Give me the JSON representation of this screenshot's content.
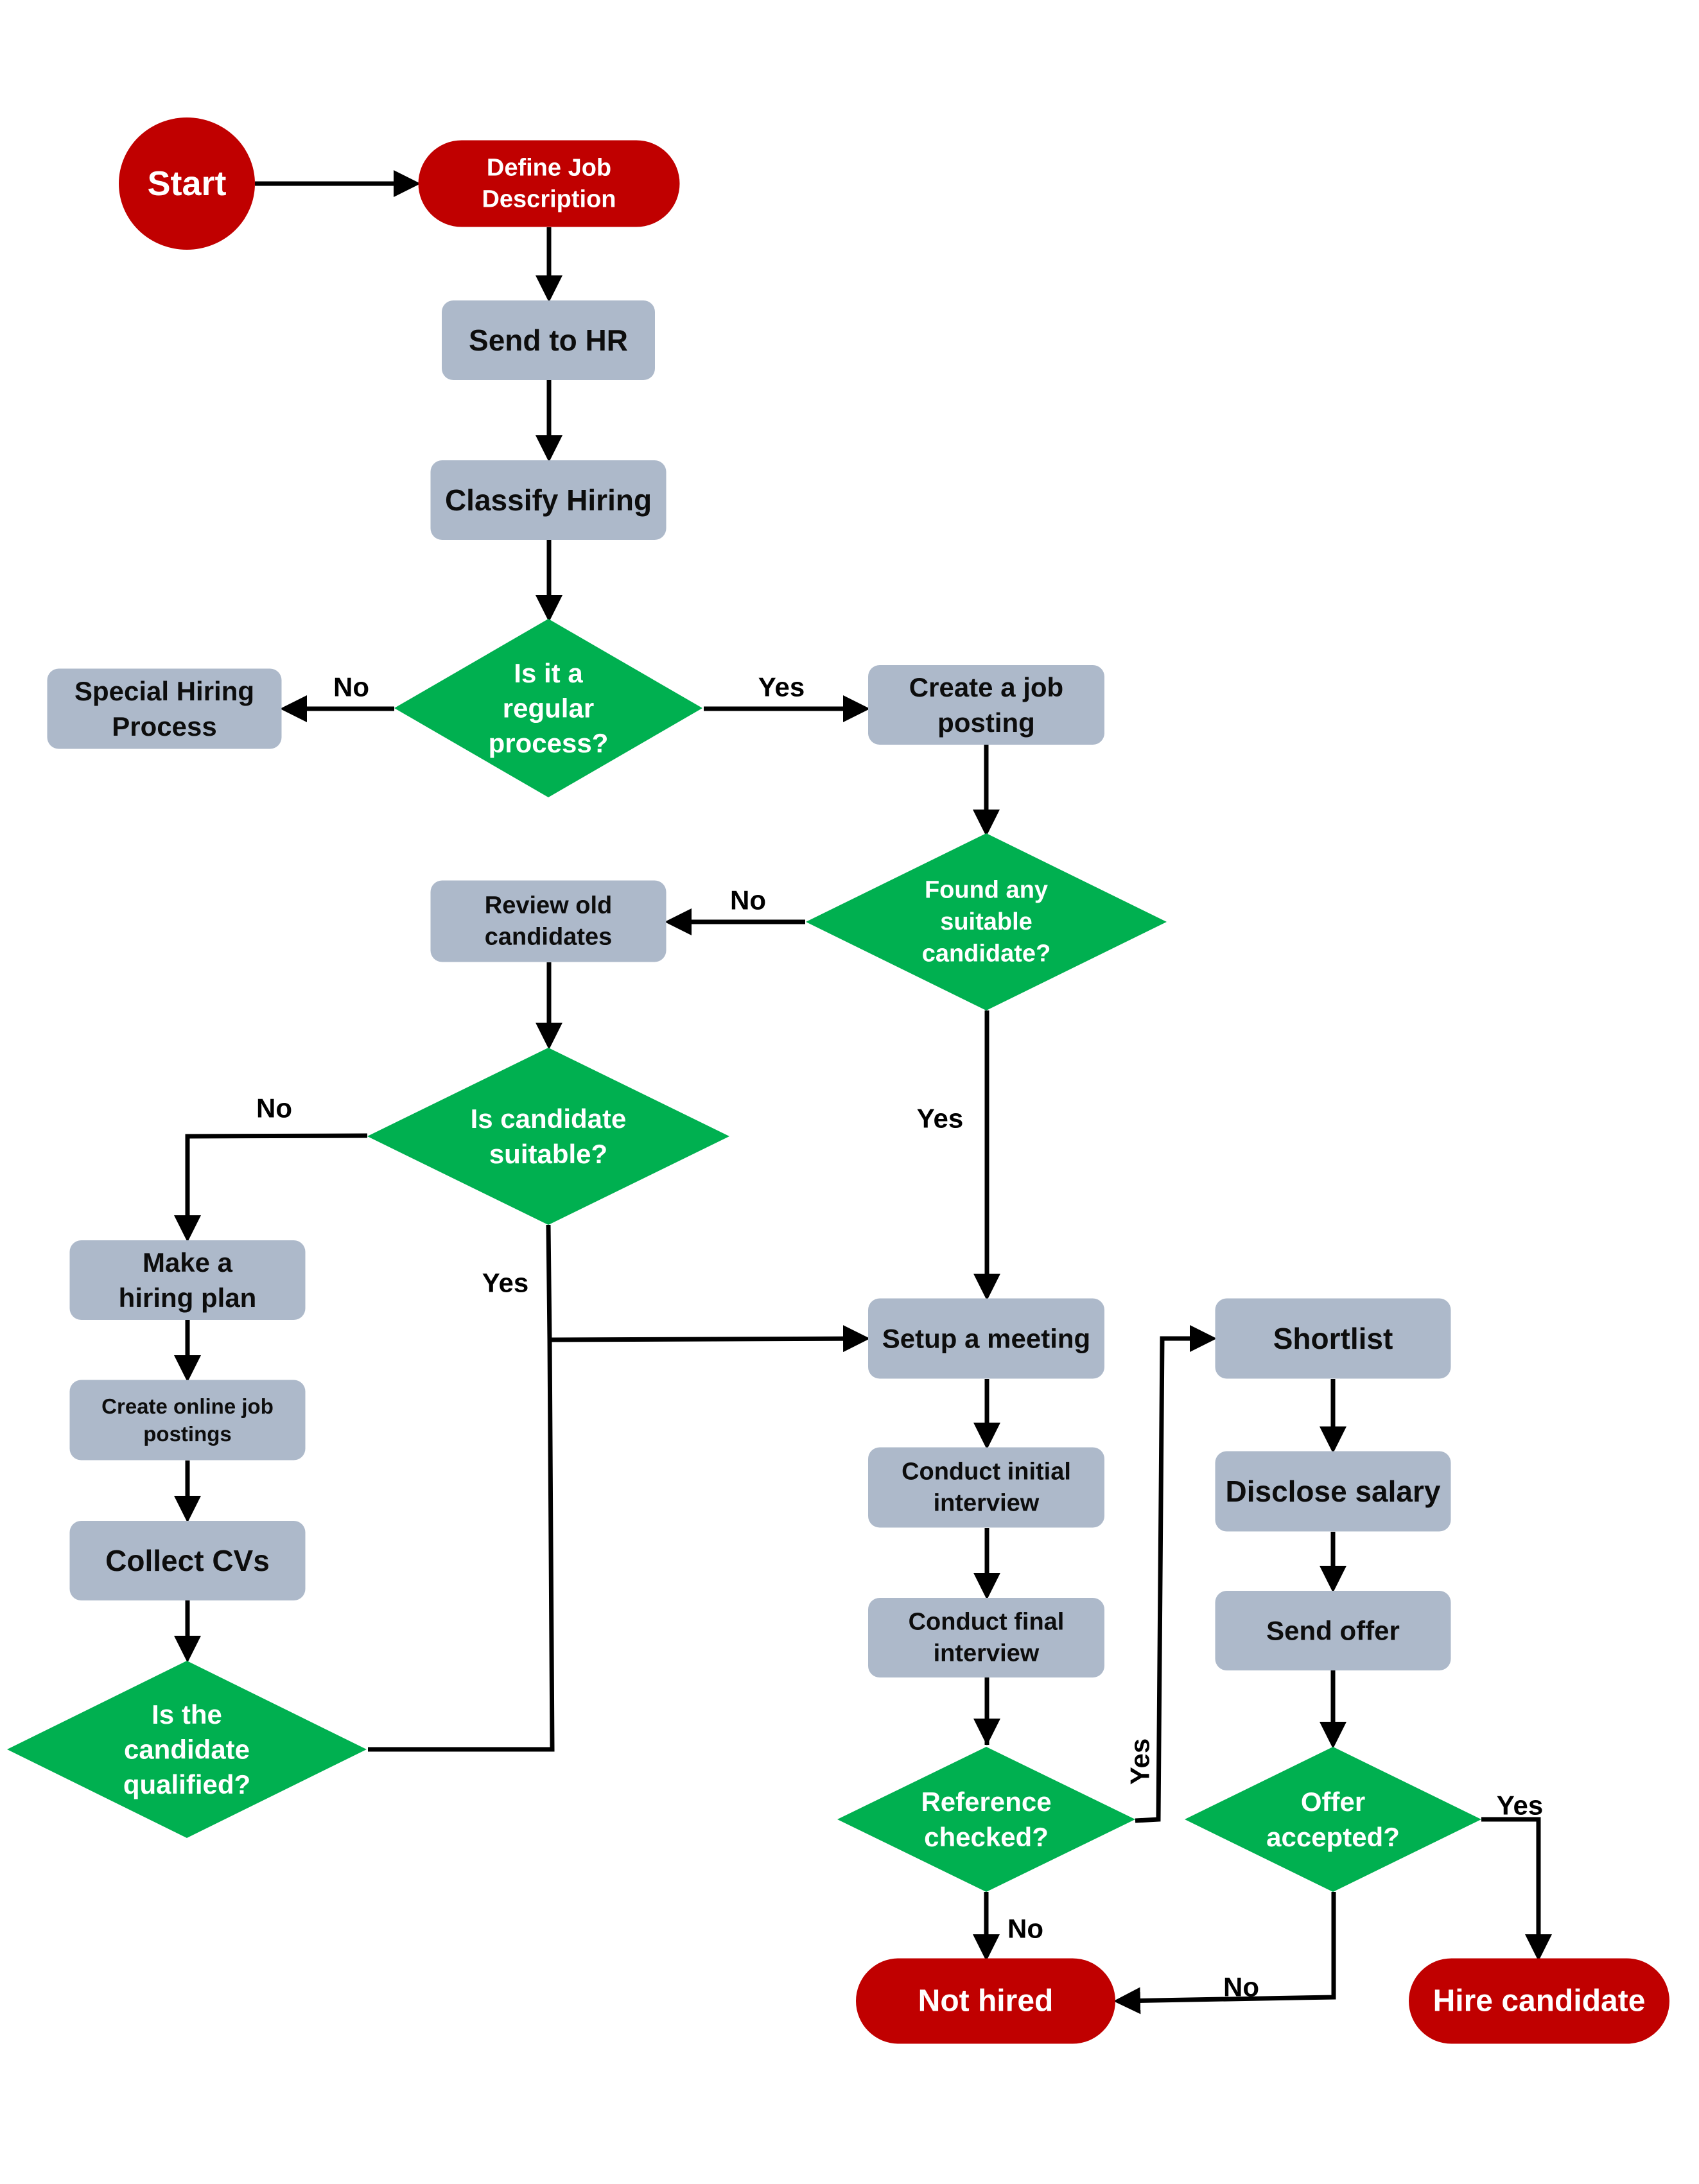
{
  "diagram": {
    "type": "flowchart",
    "colors": {
      "terminal": "#C00000",
      "process": "#ADB9CA",
      "decision": "#00B050",
      "connector": "#000000",
      "process_text": "#0D0D0D",
      "light_text": "#FFFFFF"
    },
    "nodes": {
      "start": {
        "shape": "circle",
        "lines": [
          "Start"
        ]
      },
      "define_job": {
        "shape": "terminal",
        "lines": [
          "Define Job",
          "Description"
        ]
      },
      "send_hr": {
        "shape": "process",
        "lines": [
          "Send to HR"
        ]
      },
      "classify": {
        "shape": "process",
        "lines": [
          "Classify Hiring"
        ]
      },
      "regular": {
        "shape": "decision",
        "lines": [
          "Is it a",
          "regular",
          "process?"
        ]
      },
      "special": {
        "shape": "process",
        "lines": [
          "Special Hiring",
          "Process"
        ]
      },
      "create_posting": {
        "shape": "process",
        "lines": [
          "Create a job",
          "posting"
        ]
      },
      "found_any": {
        "shape": "decision",
        "lines": [
          "Found any",
          "suitable",
          "candidate?"
        ]
      },
      "review_old": {
        "shape": "process",
        "lines": [
          "Review old",
          "candidates"
        ]
      },
      "cand_suitable": {
        "shape": "decision",
        "lines": [
          "Is candidate",
          "suitable?"
        ]
      },
      "hiring_plan": {
        "shape": "process",
        "lines": [
          "Make a",
          "hiring plan"
        ]
      },
      "online_postings": {
        "shape": "process",
        "lines": [
          "Create online job",
          "postings"
        ]
      },
      "collect_cvs": {
        "shape": "process",
        "lines": [
          "Collect CVs"
        ]
      },
      "qualified": {
        "shape": "decision",
        "lines": [
          "Is the",
          "candidate",
          "qualified?"
        ]
      },
      "setup_meeting": {
        "shape": "process",
        "lines": [
          "Setup a meeting"
        ]
      },
      "initial_interview": {
        "shape": "process",
        "lines": [
          "Conduct initial",
          "interview"
        ]
      },
      "final_interview": {
        "shape": "process",
        "lines": [
          "Conduct final",
          "interview"
        ]
      },
      "reference": {
        "shape": "decision",
        "lines": [
          "Reference",
          "checked?"
        ]
      },
      "shortlist": {
        "shape": "process",
        "lines": [
          "Shortlist"
        ]
      },
      "disclose_salary": {
        "shape": "process",
        "lines": [
          "Disclose salary"
        ]
      },
      "send_offer": {
        "shape": "process",
        "lines": [
          "Send offer"
        ]
      },
      "offer_accepted": {
        "shape": "decision",
        "lines": [
          "Offer",
          "accepted?"
        ]
      },
      "not_hired": {
        "shape": "terminal",
        "lines": [
          "Not hired"
        ]
      },
      "hire": {
        "shape": "terminal",
        "lines": [
          "Hire candidate"
        ]
      }
    },
    "edges": [
      {
        "from": "start",
        "to": "define_job",
        "label": ""
      },
      {
        "from": "define_job",
        "to": "send_hr",
        "label": ""
      },
      {
        "from": "send_hr",
        "to": "classify",
        "label": ""
      },
      {
        "from": "classify",
        "to": "regular",
        "label": ""
      },
      {
        "from": "regular",
        "to": "special",
        "label": "No"
      },
      {
        "from": "regular",
        "to": "create_posting",
        "label": "Yes"
      },
      {
        "from": "create_posting",
        "to": "found_any",
        "label": ""
      },
      {
        "from": "found_any",
        "to": "review_old",
        "label": "No"
      },
      {
        "from": "found_any",
        "to": "setup_meeting",
        "label": "Yes"
      },
      {
        "from": "review_old",
        "to": "cand_suitable",
        "label": ""
      },
      {
        "from": "cand_suitable",
        "to": "hiring_plan",
        "label": "No"
      },
      {
        "from": "cand_suitable",
        "to": "setup_meeting",
        "label": "Yes"
      },
      {
        "from": "hiring_plan",
        "to": "online_postings",
        "label": ""
      },
      {
        "from": "online_postings",
        "to": "collect_cvs",
        "label": ""
      },
      {
        "from": "collect_cvs",
        "to": "qualified",
        "label": ""
      },
      {
        "from": "qualified",
        "to": "setup_meeting",
        "label": ""
      },
      {
        "from": "setup_meeting",
        "to": "initial_interview",
        "label": ""
      },
      {
        "from": "initial_interview",
        "to": "final_interview",
        "label": ""
      },
      {
        "from": "final_interview",
        "to": "reference",
        "label": ""
      },
      {
        "from": "reference",
        "to": "shortlist",
        "label": "Yes"
      },
      {
        "from": "reference",
        "to": "not_hired",
        "label": "No"
      },
      {
        "from": "shortlist",
        "to": "disclose_salary",
        "label": ""
      },
      {
        "from": "disclose_salary",
        "to": "send_offer",
        "label": ""
      },
      {
        "from": "send_offer",
        "to": "offer_accepted",
        "label": ""
      },
      {
        "from": "offer_accepted",
        "to": "hire",
        "label": "Yes"
      },
      {
        "from": "offer_accepted",
        "to": "not_hired",
        "label": "No"
      }
    ]
  }
}
